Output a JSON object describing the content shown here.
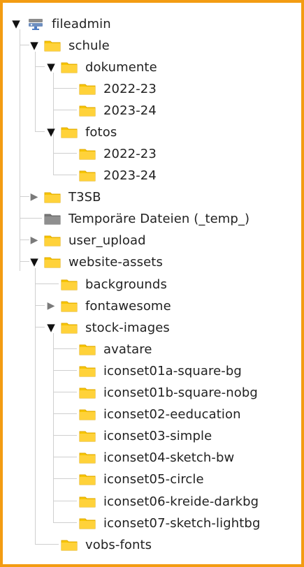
{
  "tree": {
    "root": {
      "label": "fileadmin",
      "icon": "storage-icon",
      "state": "open"
    },
    "items": [
      {
        "label": "schule",
        "icon": "folder-icon",
        "state": "open"
      },
      {
        "label": "dokumente",
        "icon": "folder-icon",
        "state": "open"
      },
      {
        "label": "2022-23",
        "icon": "folder-icon",
        "state": "leaf"
      },
      {
        "label": "2023-24",
        "icon": "folder-icon",
        "state": "leaf"
      },
      {
        "label": "fotos",
        "icon": "folder-icon",
        "state": "open"
      },
      {
        "label": "2022-23",
        "icon": "folder-icon",
        "state": "leaf"
      },
      {
        "label": "2023-24",
        "icon": "folder-icon",
        "state": "leaf"
      },
      {
        "label": "T3SB",
        "icon": "folder-icon",
        "state": "closed"
      },
      {
        "label": "Temporäre Dateien (_temp_)",
        "icon": "temp-folder-icon",
        "state": "leaf"
      },
      {
        "label": "user_upload",
        "icon": "folder-icon",
        "state": "closed"
      },
      {
        "label": "website-assets",
        "icon": "folder-icon",
        "state": "open"
      },
      {
        "label": "backgrounds",
        "icon": "folder-icon",
        "state": "leaf"
      },
      {
        "label": "fontawesome",
        "icon": "folder-icon",
        "state": "closed"
      },
      {
        "label": "stock-images",
        "icon": "folder-icon",
        "state": "open"
      },
      {
        "label": "avatare",
        "icon": "folder-icon",
        "state": "leaf"
      },
      {
        "label": "iconset01a-square-bg",
        "icon": "folder-icon",
        "state": "leaf"
      },
      {
        "label": "iconset01b-square-nobg",
        "icon": "folder-icon",
        "state": "leaf"
      },
      {
        "label": "iconset02-eeducation",
        "icon": "folder-icon",
        "state": "leaf"
      },
      {
        "label": "iconset03-simple",
        "icon": "folder-icon",
        "state": "leaf"
      },
      {
        "label": "iconset04-sketch-bw",
        "icon": "folder-icon",
        "state": "leaf"
      },
      {
        "label": "iconset05-circle",
        "icon": "folder-icon",
        "state": "leaf"
      },
      {
        "label": "iconset06-kreide-darkbg",
        "icon": "folder-icon",
        "state": "leaf"
      },
      {
        "label": "iconset07-sketch-lightbg",
        "icon": "folder-icon",
        "state": "leaf"
      },
      {
        "label": "vobs-fonts",
        "icon": "folder-icon",
        "state": "leaf"
      }
    ]
  },
  "colors": {
    "frame": "#f39c12",
    "folder": "#f7c600",
    "folder_edge": "#e0a800",
    "temp_folder": "#8a8a8a",
    "tree_line": "#cfcfcf"
  }
}
